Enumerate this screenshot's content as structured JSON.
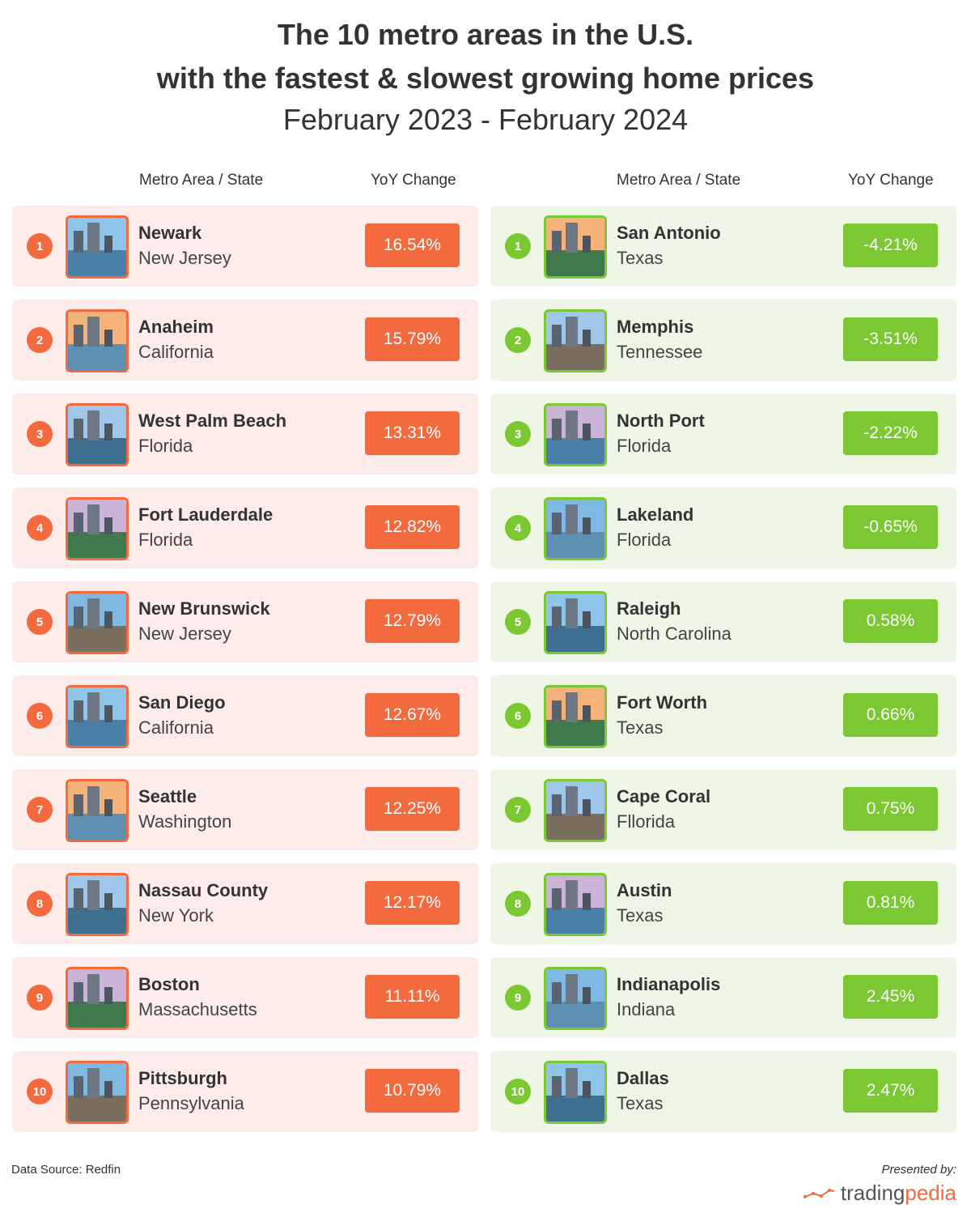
{
  "header": {
    "title_line1": "The 10 metro areas in the U.S.",
    "title_line2": "with the fastest & slowest growing home prices",
    "subtitle": "February 2023 - February 2024"
  },
  "columns": {
    "area": "Metro Area / State",
    "change": "YoY Change"
  },
  "colors": {
    "fastest": "#f26a3e",
    "fastest_bg": "#fdecea",
    "slowest": "#7cc832",
    "slowest_bg": "#eef7e5"
  },
  "chart_data": {
    "type": "table",
    "tables": [
      {
        "group": "fastest",
        "rows": [
          {
            "rank": "1",
            "city": "Newark",
            "state": "New Jersey",
            "change": "16.54%",
            "value": 16.54
          },
          {
            "rank": "2",
            "city": "Anaheim",
            "state": "California",
            "change": "15.79%",
            "value": 15.79
          },
          {
            "rank": "3",
            "city": "West Palm Beach",
            "state": "Florida",
            "change": "13.31%",
            "value": 13.31
          },
          {
            "rank": "4",
            "city": "Fort Lauderdale",
            "state": "Florida",
            "change": "12.82%",
            "value": 12.82
          },
          {
            "rank": "5",
            "city": "New Brunswick",
            "state": "New Jersey",
            "change": "12.79%",
            "value": 12.79
          },
          {
            "rank": "6",
            "city": "San Diego",
            "state": "California",
            "change": "12.67%",
            "value": 12.67
          },
          {
            "rank": "7",
            "city": "Seattle",
            "state": "Washington",
            "change": "12.25%",
            "value": 12.25
          },
          {
            "rank": "8",
            "city": "Nassau County",
            "state": "New York",
            "change": "12.17%",
            "value": 12.17
          },
          {
            "rank": "9",
            "city": "Boston",
            "state": "Massachusetts",
            "change": "11.11%",
            "value": 11.11
          },
          {
            "rank": "10",
            "city": "Pittsburgh",
            "state": "Pennsylvania",
            "change": "10.79%",
            "value": 10.79
          }
        ]
      },
      {
        "group": "slowest",
        "rows": [
          {
            "rank": "1",
            "city": "San Antonio",
            "state": "Texas",
            "change": "-4.21%",
            "value": -4.21
          },
          {
            "rank": "2",
            "city": "Memphis",
            "state": "Tennessee",
            "change": "-3.51%",
            "value": -3.51
          },
          {
            "rank": "3",
            "city": "North Port",
            "state": "Florida",
            "change": "-2.22%",
            "value": -2.22
          },
          {
            "rank": "4",
            "city": "Lakeland",
            "state": "Florida",
            "change": "-0.65%",
            "value": -0.65
          },
          {
            "rank": "5",
            "city": "Raleigh",
            "state": "North Carolina",
            "change": "0.58%",
            "value": 0.58
          },
          {
            "rank": "6",
            "city": "Fort Worth",
            "state": "Texas",
            "change": "0.66%",
            "value": 0.66
          },
          {
            "rank": "7",
            "city": "Cape Coral",
            "state": "Fllorida",
            "change": "0.75%",
            "value": 0.75
          },
          {
            "rank": "8",
            "city": "Austin",
            "state": "Texas",
            "change": "0.81%",
            "value": 0.81
          },
          {
            "rank": "9",
            "city": "Indianapolis",
            "state": "Indiana",
            "change": "2.45%",
            "value": 2.45
          },
          {
            "rank": "10",
            "city": "Dallas",
            "state": "Texas",
            "change": "2.47%",
            "value": 2.47
          }
        ]
      }
    ]
  },
  "footer": {
    "source": "Data Source: Redfin",
    "presented_by": "Presented by:",
    "brand_a": "trading",
    "brand_b": "pedia"
  }
}
